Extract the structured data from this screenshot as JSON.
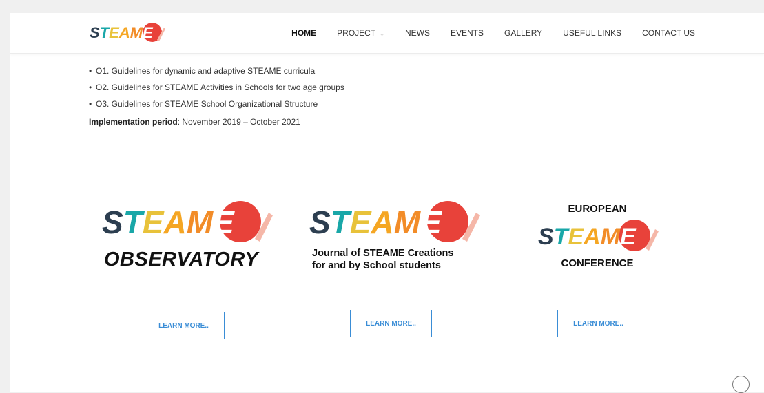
{
  "brand": {
    "logo_letters": [
      "S",
      "T",
      "E",
      "A",
      "M",
      "E"
    ],
    "colors": {
      "s": "#2c3e50",
      "t": "#19a7a8",
      "e": "#e8c23a",
      "a": "#f5a623",
      "m": "#f28c28",
      "ball": "#e8423a"
    }
  },
  "nav": {
    "items": [
      {
        "label": "HOME",
        "active": true
      },
      {
        "label": "PROJECT",
        "has_dropdown": true
      },
      {
        "label": "NEWS"
      },
      {
        "label": "EVENTS"
      },
      {
        "label": "GALLERY"
      },
      {
        "label": "USEFUL LINKS"
      },
      {
        "label": "CONTACT US"
      }
    ]
  },
  "content": {
    "bullets": [
      "O1. Guidelines for dynamic and adaptive STEAME curricula",
      "O2. Guidelines for STEAME Activities in Schools for two age groups",
      "O3. Guidelines for STEAME School Organizational Structure"
    ],
    "implementation_label": "Implementation period",
    "implementation_value": ": November 2019 – October 2021"
  },
  "cards": [
    {
      "subtitle": "OBSERVATORY",
      "button": "LEARN MORE.."
    },
    {
      "subtitle_line1": "Journal of STEAME Creations",
      "subtitle_line2": "for and by School students",
      "button": "LEARN MORE.."
    },
    {
      "top": "EUROPEAN",
      "bottom": "CONFERENCE",
      "button": "LEARN MORE.."
    }
  ],
  "scroll_top_icon": "arrow-up-icon"
}
